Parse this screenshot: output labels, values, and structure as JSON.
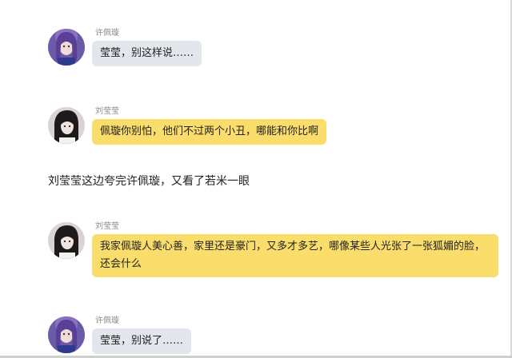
{
  "messages": [
    {
      "sender": "许佩璇",
      "avatar_icon": "girl-purple-hair-avatar-icon",
      "bubble_color": "#e3e6ec",
      "text": "莹莹，别这样说……"
    },
    {
      "sender": "刘莹莹",
      "avatar_icon": "girl-dark-hair-avatar-icon",
      "bubble_color": "#fbdd6c",
      "text": "佩璇你别怕，他们不过两个小丑，哪能和你比啊"
    },
    {
      "sender": "刘莹莹",
      "avatar_icon": "girl-dark-hair-avatar-icon",
      "bubble_color": "#fbdd6c",
      "text": "我家佩璇人美心善，家里还是豪门，又多才多艺，哪像某些人光张了一张狐媚的脸，还会什么"
    },
    {
      "sender": "许佩璇",
      "avatar_icon": "girl-purple-hair-avatar-icon",
      "bubble_color": "#e3e6ec",
      "text": "莹莹，别说了……"
    }
  ],
  "narration": "刘莹莹这边夸完许佩璇，又看了若米一眼"
}
